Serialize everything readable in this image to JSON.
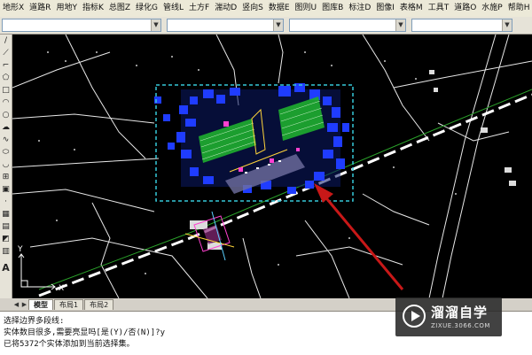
{
  "menu": {
    "items": [
      "地形X",
      "道路R",
      "用地Y",
      "指标K",
      "总图Z",
      "绿化G",
      "管线L",
      "土方F",
      "湍动D",
      "竖向S",
      "数据E",
      "图则U",
      "图库B",
      "标注D",
      "图像I",
      "表格M",
      "工具T",
      "道路O",
      "水施P",
      "帮助H"
    ]
  },
  "colors": {
    "canvas_bg": "#000000",
    "selection_box": "#35c7d8",
    "selected_entities": "#1f3cff",
    "green_hatch": "#1fae2f",
    "annotation_arrow": "#c81818",
    "road_lines": "#ffffff"
  },
  "left_toolbar": {
    "icons": [
      "line-tool-icon",
      "construction-line-icon",
      "polyline-icon",
      "polygon-icon",
      "rectangle-icon",
      "arc-icon",
      "circle-icon",
      "revision-cloud-icon",
      "spline-icon",
      "ellipse-icon",
      "ellipse-arc-icon",
      "insert-block-icon",
      "make-block-icon",
      "point-icon",
      "hatch-icon",
      "gradient-icon",
      "region-icon",
      "table-icon",
      "multiline-text-icon"
    ],
    "text_glyph": "A"
  },
  "canvas": {
    "ucs_x_label": "X",
    "ucs_y_label": "Y"
  },
  "tabs": [
    "模型",
    "布局1",
    "布局2"
  ],
  "command": {
    "lines": [
      "选择边界多段线:",
      "实体数目很多,需要亮显吗[是(Y)/否(N)]?y",
      "已将5372个实体添加到当前选择集。"
    ]
  },
  "watermark": {
    "name": "溜溜自学",
    "url": "ZIXUE.3066.COM"
  }
}
